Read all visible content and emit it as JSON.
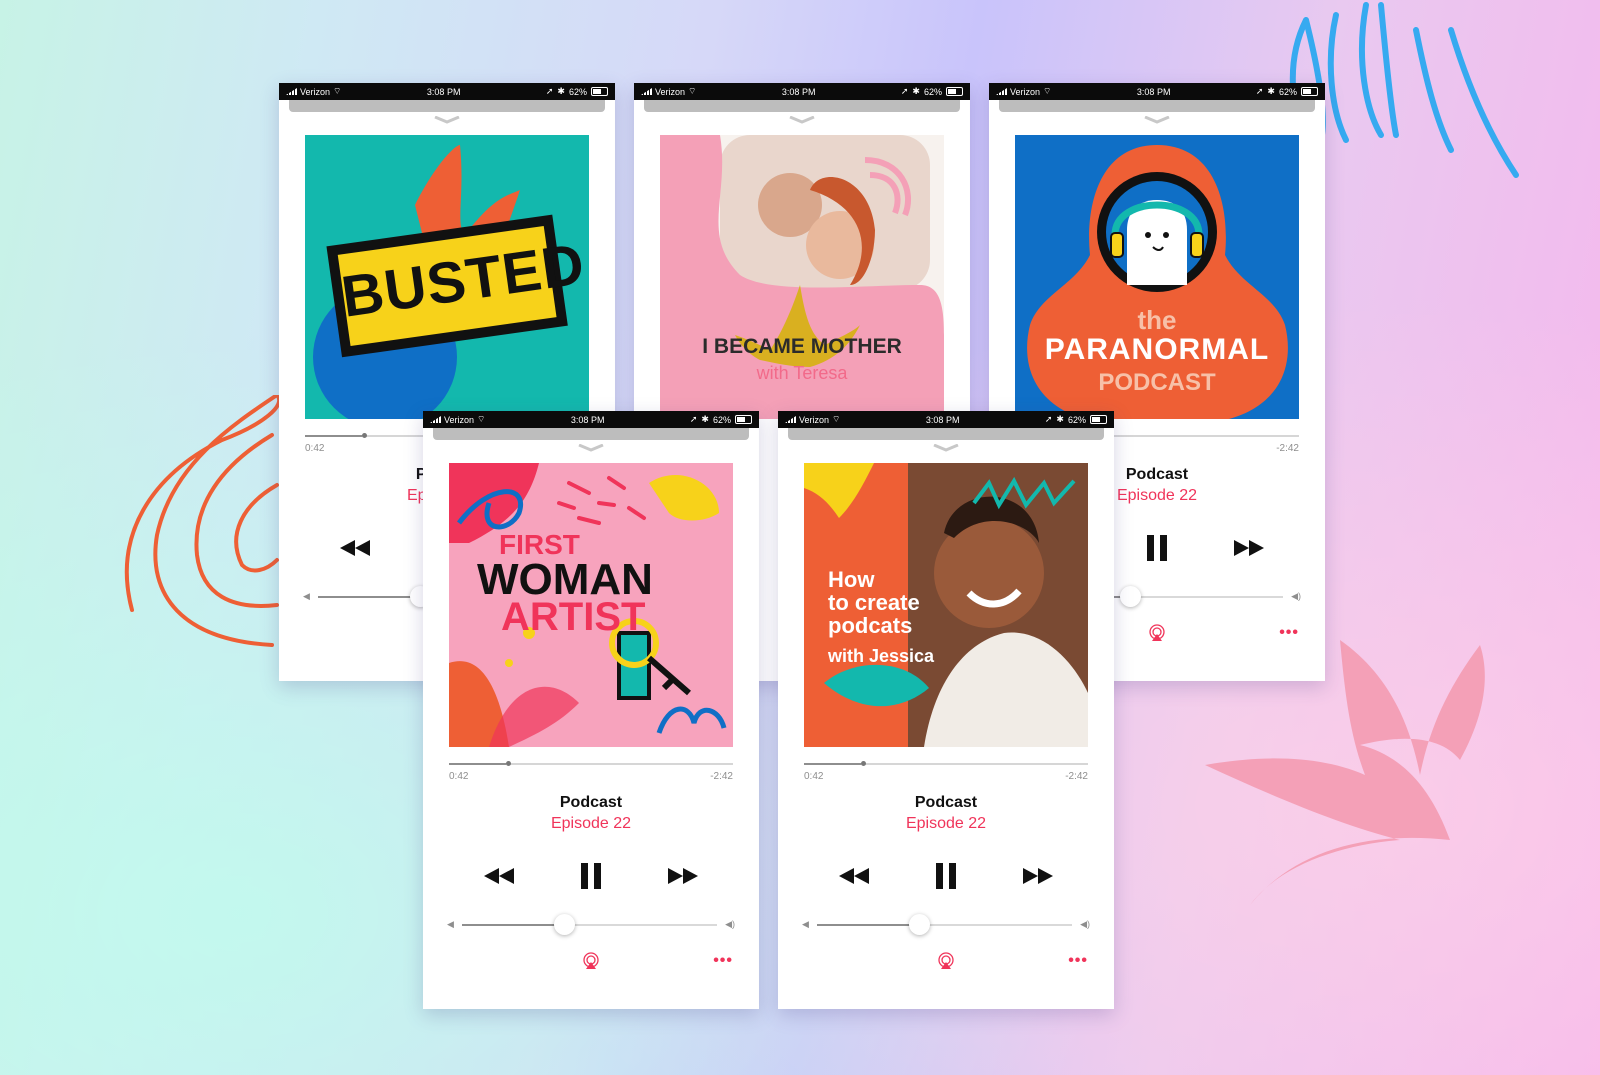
{
  "status_bar": {
    "carrier": "Verizon",
    "time": "3:08 PM",
    "battery": "62%"
  },
  "player": {
    "title": "Podcast",
    "subtitle": "Episode 22",
    "elapsed": "0:42",
    "remaining": "-2:42",
    "progress_fraction": 0.2,
    "volume_fraction": 0.4
  },
  "artworks": {
    "busted": {
      "title": "BUSTED"
    },
    "mother": {
      "title": "I BECAME MOTHER",
      "subtitle": "with Teresa"
    },
    "paranormal": {
      "line1": "the",
      "line2": "PARANORMAL",
      "line3": "PODCAST"
    },
    "woman_artist": {
      "line1": "FIRST",
      "line2": "WOMAN",
      "line3": "ARTIST"
    },
    "create_podcasts": {
      "line1": "How",
      "line2": "to create",
      "line3": "podcats",
      "line4": "with Jessica"
    }
  },
  "colors": {
    "accent": "#f0345a",
    "teal": "#13b8ad",
    "orange": "#ee5f35",
    "blue": "#0f6fc6",
    "pink": "#f4a0b7",
    "yellow": "#f7d21a"
  }
}
